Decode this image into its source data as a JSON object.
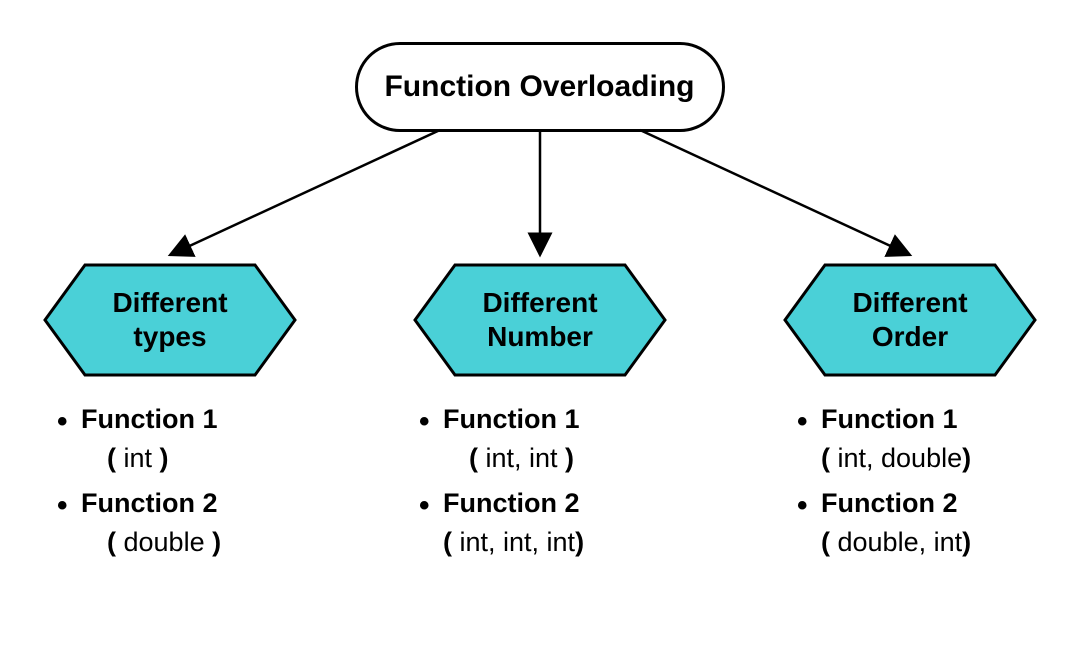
{
  "root": {
    "title": "Function Overloading"
  },
  "colors": {
    "hexFill": "#4ad0d7",
    "hexStroke": "#000000"
  },
  "branches": [
    {
      "id": "types",
      "label_line1": "Different",
      "label_line2": "types",
      "functions": [
        {
          "name": "Function 1",
          "open": "( ",
          "params": "int",
          "close": " )",
          "indent": true
        },
        {
          "name": "Function 2",
          "open": "( ",
          "params": "double",
          "close": " )",
          "indent": true
        }
      ]
    },
    {
      "id": "number",
      "label_line1": "Different",
      "label_line2": "Number",
      "functions": [
        {
          "name": "Function 1",
          "open": "( ",
          "params": "int, int",
          "close": " )",
          "indent": true
        },
        {
          "name": "Function 2",
          "open": "( ",
          "params": "int, int,  int",
          "close": ")",
          "indent": false
        }
      ]
    },
    {
      "id": "order",
      "label_line1": "Different",
      "label_line2": "Order",
      "functions": [
        {
          "name": "Function 1",
          "open": "( ",
          "params": "int, double",
          "close": ")",
          "indent": false
        },
        {
          "name": "Function 2",
          "open": "( ",
          "params": "double, int",
          "close": ")",
          "indent": false
        }
      ]
    }
  ]
}
